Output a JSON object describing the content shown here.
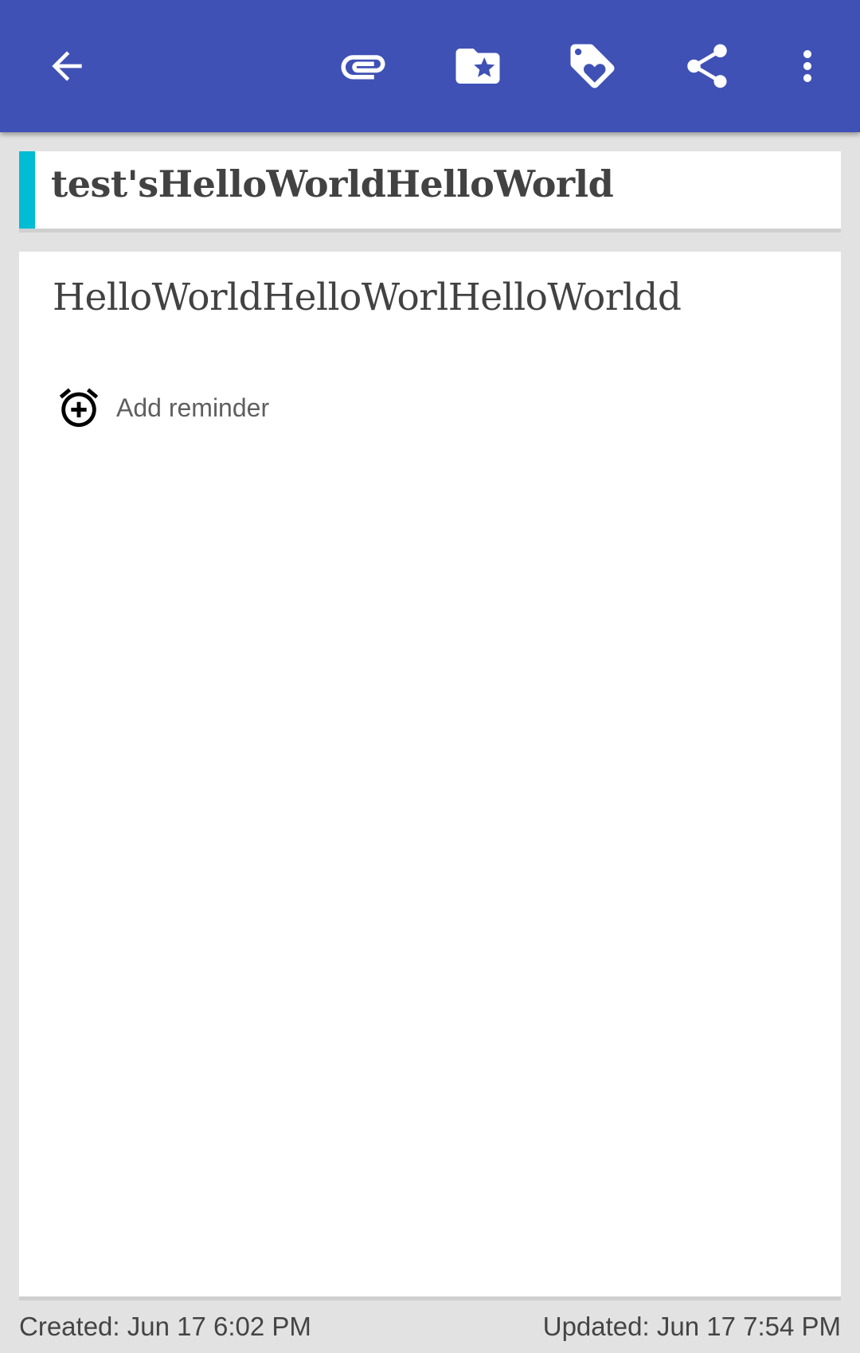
{
  "toolbar": {
    "background": "#3f51b5",
    "icons": {
      "back": "arrow-back-icon",
      "attach": "attachment-icon",
      "category": "folder-star-icon",
      "tag": "tag-heart-icon",
      "share": "share-icon",
      "more": "more-vert-icon"
    }
  },
  "note": {
    "accent_color": "#00bcd4",
    "title": "test'sHelloWorldHelloWorld",
    "content": "HelloWorldHelloWorlHelloWorldd"
  },
  "reminder": {
    "icon": "alarm-add-icon",
    "label": "Add reminder"
  },
  "footer": {
    "created": "Created: Jun 17 6:02 PM",
    "updated": "Updated: Jun 17 7:54 PM"
  }
}
